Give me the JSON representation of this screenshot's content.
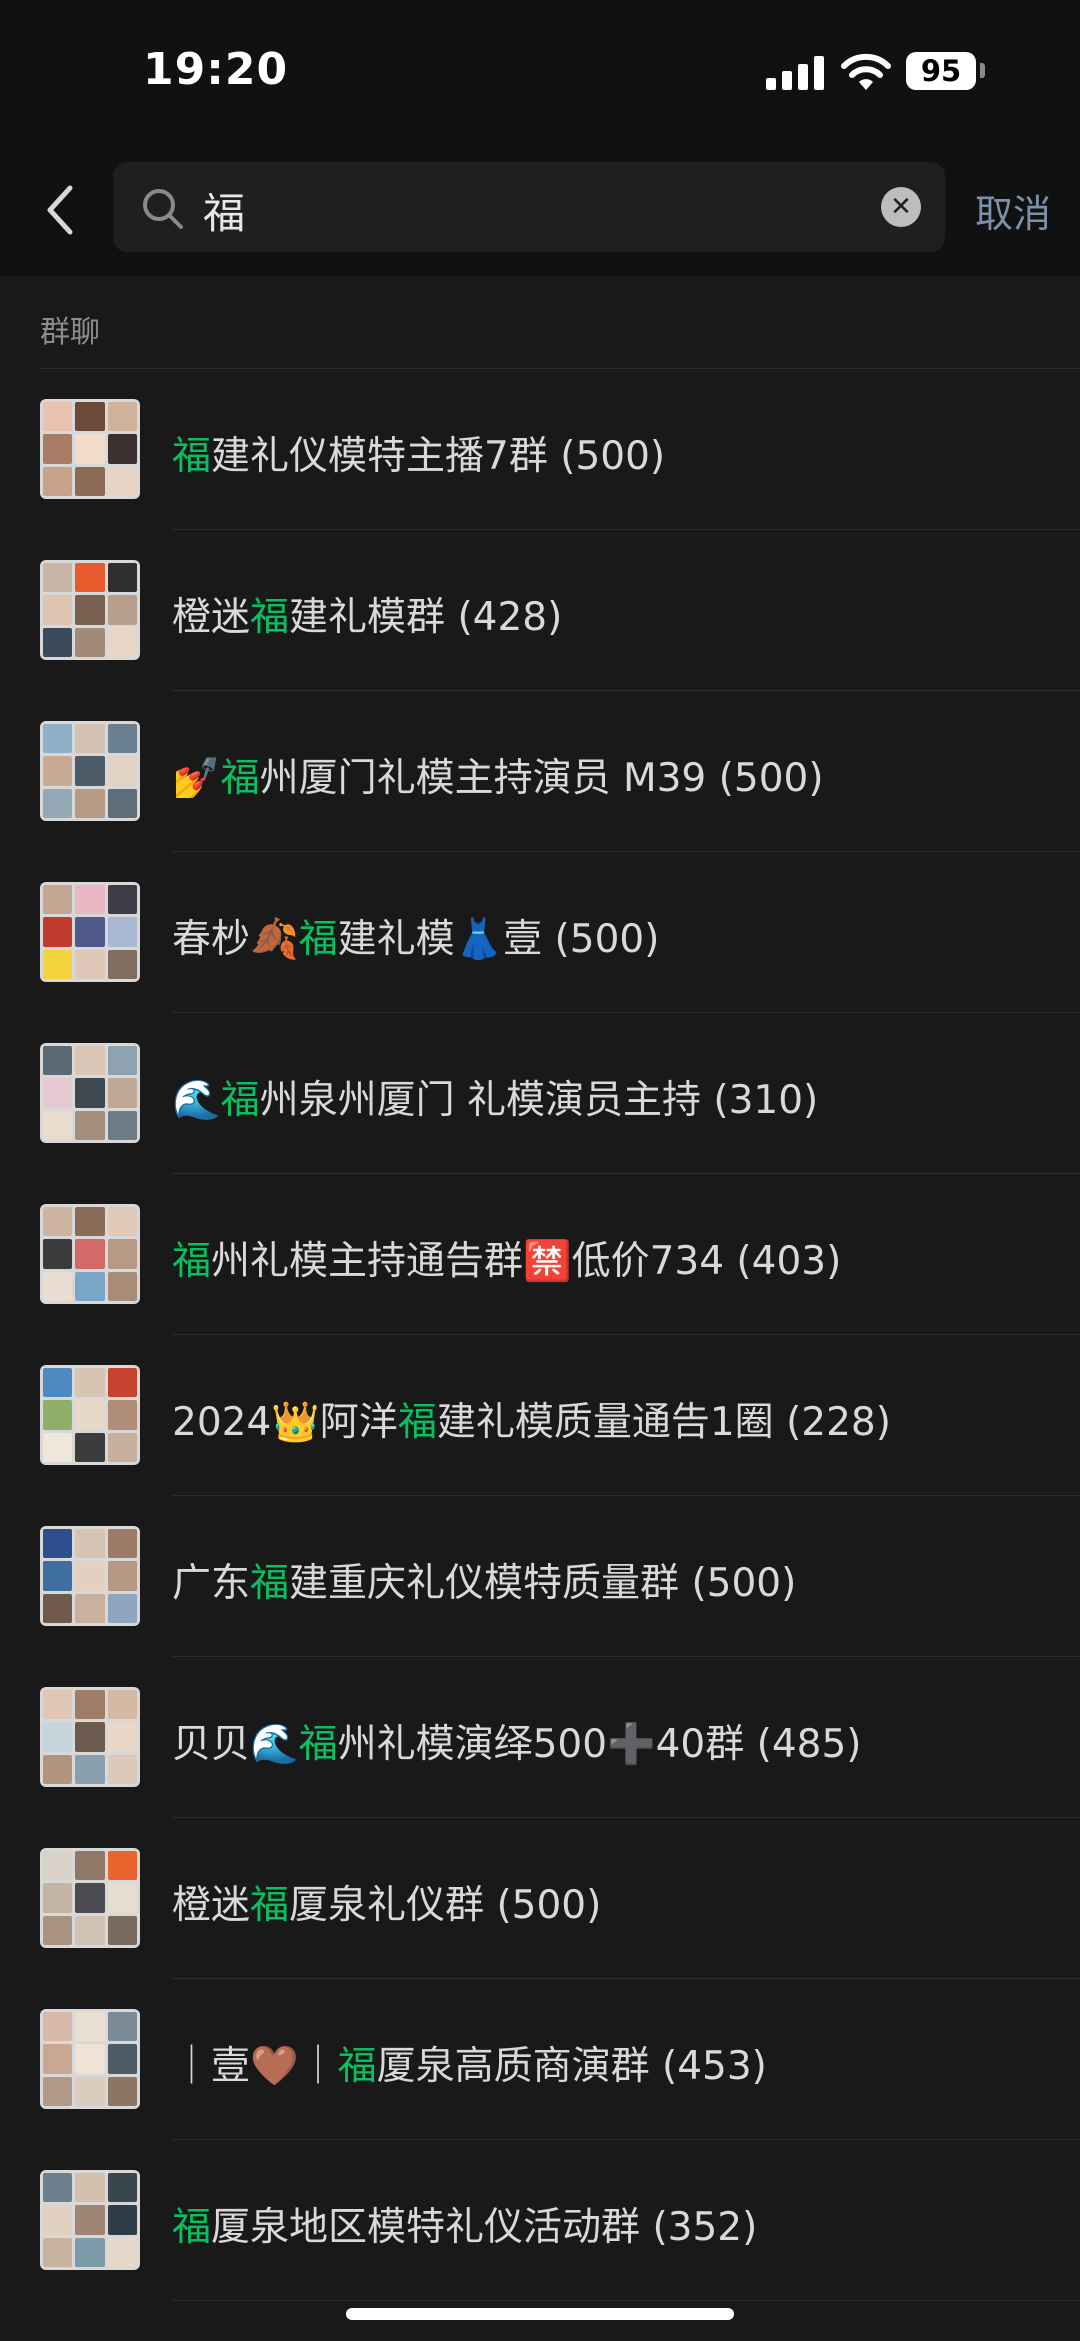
{
  "status_bar": {
    "time": "19:20",
    "battery": "95"
  },
  "search": {
    "query": "福",
    "cancel_label": "取消"
  },
  "section": {
    "title": "群聊"
  },
  "colors": {
    "keyword_highlight": "#06c160",
    "cancel_link": "#7d90a9",
    "background": "#191919"
  },
  "groups": [
    {
      "prefix": "",
      "keyword": "福",
      "suffix": "建礼仪模特主播7群",
      "count": "(500)",
      "palette": [
        "#e9c1b0",
        "#6b4a3a",
        "#d0b29a",
        "#a87b65",
        "#f1dccb",
        "#3d3030",
        "#c7a28b",
        "#8c6a55",
        "#e6d3c3"
      ]
    },
    {
      "prefix": "橙迷",
      "keyword": "福",
      "suffix": "建礼模群",
      "count": "(428)",
      "palette": [
        "#c9b5a5",
        "#e85b2c",
        "#2f2f2f",
        "#dcc4b2",
        "#7a6050",
        "#b89f8d",
        "#3a4a5a",
        "#a28a78",
        "#e7d5c6"
      ]
    },
    {
      "prefix": "💅",
      "keyword": "福",
      "suffix": "州厦门礼模主持演员 M39",
      "count": "(500)",
      "palette": [
        "#8fb0c9",
        "#d4c1b1",
        "#6a7f8f",
        "#c8a994",
        "#4c5a66",
        "#e2d2c4",
        "#93a7b5",
        "#b59a86",
        "#5d6d7a"
      ]
    },
    {
      "prefix": "春杪🍂",
      "keyword": "福",
      "suffix": "建礼模👗壹",
      "count": "(500)",
      "palette": [
        "#c4a793",
        "#e9b7c4",
        "#3c3c44",
        "#c23a2e",
        "#4f5a8a",
        "#a7b8d0",
        "#f4d23c",
        "#dcc7b8",
        "#7f6d60"
      ]
    },
    {
      "prefix": "🌊",
      "keyword": "福",
      "suffix": "州泉州厦门 礼模演员主持",
      "count": "(310)",
      "palette": [
        "#5b6a75",
        "#d9c6b6",
        "#8fa2b0",
        "#e6c8d0",
        "#3e4850",
        "#c1a894",
        "#e8dccc",
        "#a38d7c",
        "#6e7c86"
      ]
    },
    {
      "prefix": "",
      "keyword": "福",
      "suffix": "州礼模主持通告群🈲低价734",
      "count": "(403)",
      "palette": [
        "#cdb3a0",
        "#8a6b58",
        "#e0cbbb",
        "#3b3b3b",
        "#d36a6a",
        "#b69a86",
        "#e9dcd0",
        "#79a6c6",
        "#a88c78"
      ]
    },
    {
      "prefix": "2024👑阿洋",
      "keyword": "福",
      "suffix": "建礼模质量通告1圈",
      "count": "(228)",
      "palette": [
        "#4e8ac1",
        "#d8c4b2",
        "#c9412f",
        "#8fae6a",
        "#e8d8c8",
        "#b08d76",
        "#f1e6da",
        "#3c3c3c",
        "#c7b09c"
      ]
    },
    {
      "prefix": "广东",
      "keyword": "福",
      "suffix": "建重庆礼仪模特质量群",
      "count": "(500)",
      "palette": [
        "#2e4f8f",
        "#d5c3b4",
        "#9c7c66",
        "#3f6f9e",
        "#e2d0c1",
        "#b59883",
        "#6f5a4c",
        "#c9b19e",
        "#8da5bd"
      ]
    },
    {
      "prefix": "贝贝🌊",
      "keyword": "福",
      "suffix": "州礼模演绎500➕40群",
      "count": "(485)",
      "palette": [
        "#e0c6b4",
        "#9f7c66",
        "#d4b8a4",
        "#c6d4dc",
        "#6d5a4e",
        "#e9d7c7",
        "#b3957f",
        "#8aa0ae",
        "#dbc9b9"
      ]
    },
    {
      "prefix": "橙迷",
      "keyword": "福",
      "suffix": "厦泉礼仪群",
      "count": "(500)",
      "palette": [
        "#d9d2c8",
        "#8f7868",
        "#e8632e",
        "#c4b4a6",
        "#4b4b52",
        "#e6dcd0",
        "#a9927f",
        "#d2c2b4",
        "#7b6a5e"
      ]
    },
    {
      "prefix": "｜壹🤎｜",
      "keyword": "福",
      "suffix": "厦泉高质商演群",
      "count": "(453)",
      "palette": [
        "#d6b9a8",
        "#e9dfd3",
        "#7a8b97",
        "#c8a892",
        "#f0e3d5",
        "#4e5a63",
        "#b39a88",
        "#dcccbe",
        "#8c7565"
      ]
    },
    {
      "prefix": "",
      "keyword": "福",
      "suffix": "厦泉地区模特礼仪活动群",
      "count": "(352)",
      "palette": [
        "#6c7f8c",
        "#d3bfae",
        "#3a464e",
        "#e1cfc0",
        "#9e8573",
        "#2f3d46",
        "#c8b3a1",
        "#7c9aa8",
        "#e6d8ca"
      ]
    }
  ]
}
